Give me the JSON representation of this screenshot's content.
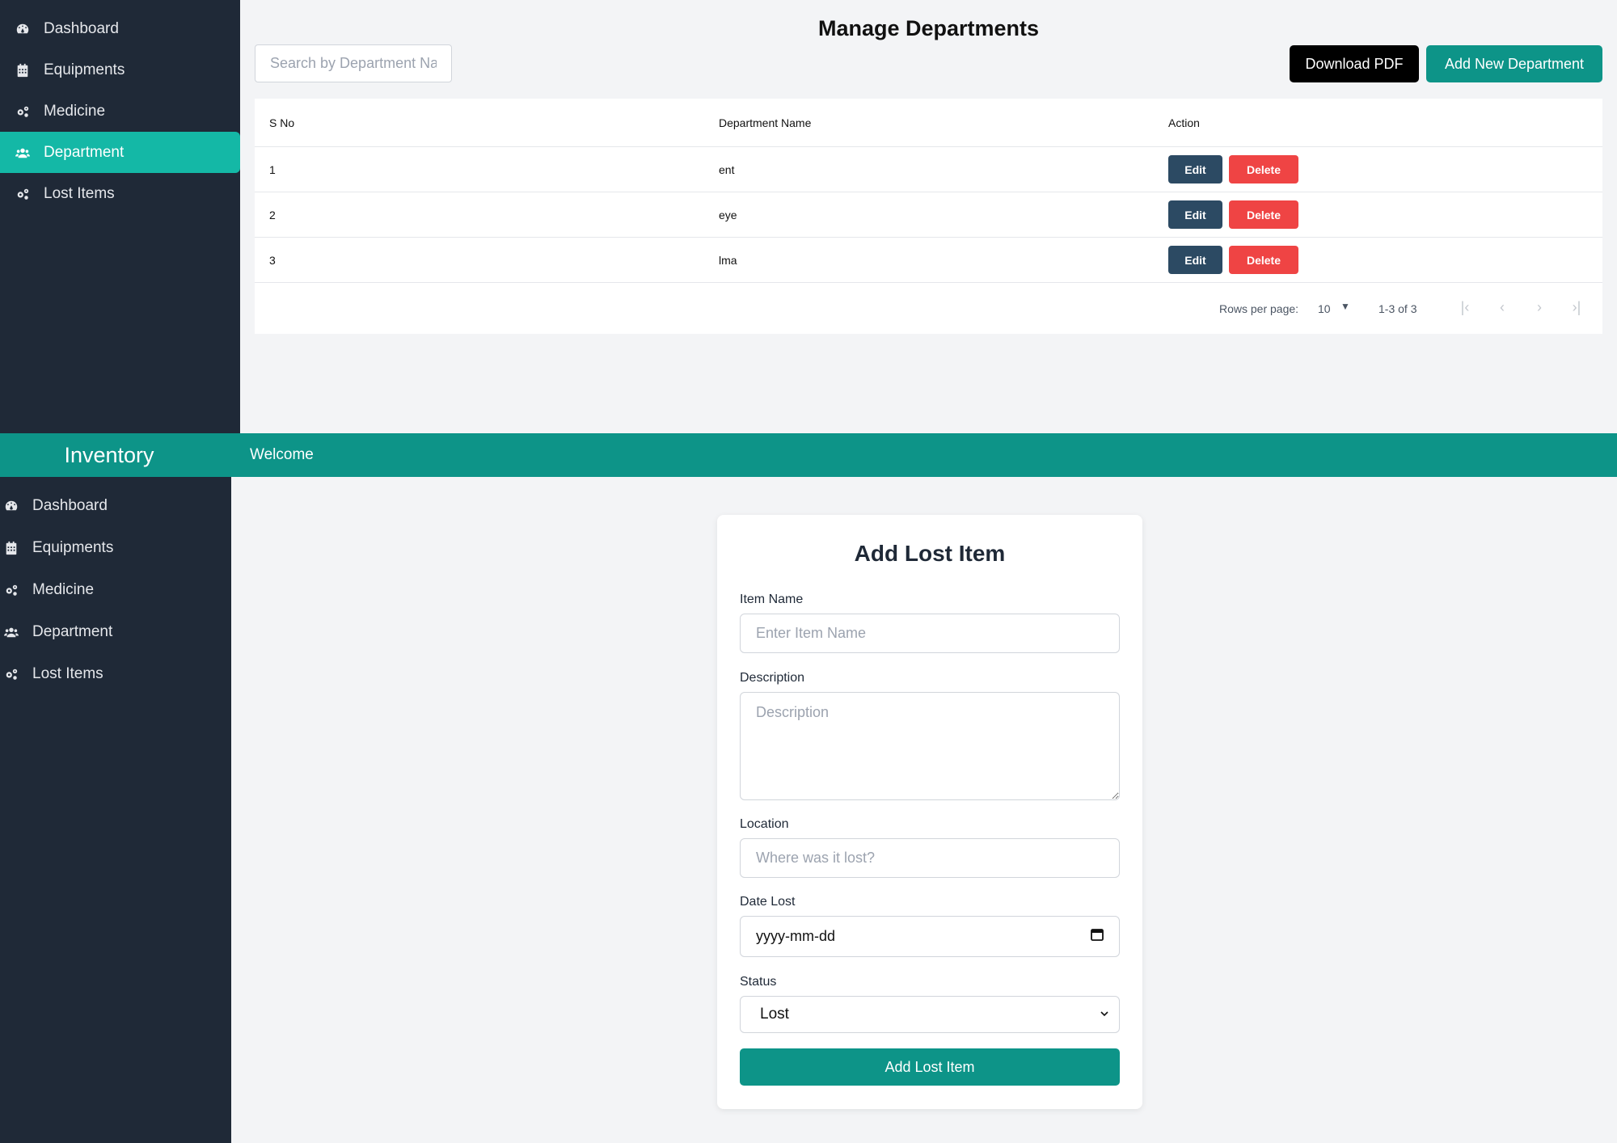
{
  "sidebar": {
    "items": [
      {
        "label": "Dashboard",
        "icon": "dashboard-icon"
      },
      {
        "label": "Equipments",
        "icon": "calendar-icon"
      },
      {
        "label": "Medicine",
        "icon": "cogs-icon"
      },
      {
        "label": "Department",
        "icon": "users-icon"
      },
      {
        "label": "Lost Items",
        "icon": "cogs-icon"
      }
    ],
    "active": "Department"
  },
  "departments_page": {
    "title": "Manage Departments",
    "search_placeholder": "Search by Department Name",
    "download_pdf_label": "Download PDF",
    "add_department_label": "Add New Department",
    "table": {
      "headers": [
        "S No",
        "Department Name",
        "Action"
      ],
      "rows": [
        {
          "sno": "1",
          "name": "ent"
        },
        {
          "sno": "2",
          "name": "eye"
        },
        {
          "sno": "3",
          "name": "lma"
        }
      ],
      "edit_label": "Edit",
      "delete_label": "Delete"
    },
    "pagination": {
      "rows_per_page_label": "Rows per page:",
      "rows_per_page_value": "10",
      "range": "1-3 of 3"
    }
  },
  "header": {
    "brand": "Inventory",
    "welcome": "Welcome"
  },
  "lost_item_form": {
    "title": "Add Lost Item",
    "item_name_label": "Item Name",
    "item_name_placeholder": "Enter Item Name",
    "description_label": "Description",
    "description_placeholder": "Description",
    "location_label": "Location",
    "location_placeholder": "Where was it lost?",
    "date_label": "Date Lost",
    "date_placeholder": "yyyy-mm-dd",
    "status_label": "Status",
    "status_value": "Lost",
    "submit_label": "Add Lost Item"
  },
  "colors": {
    "sidebar_bg": "#1f2937",
    "accent": "#14b8a6",
    "header_bg": "#0d9488",
    "edit_button": "#2c4a63",
    "delete_button": "#ef4444"
  }
}
